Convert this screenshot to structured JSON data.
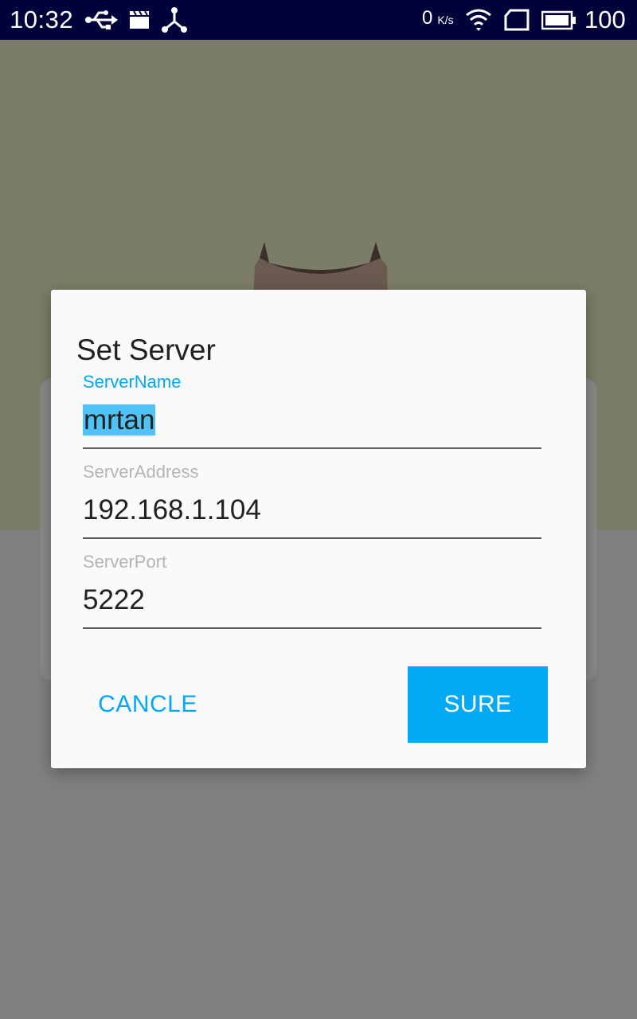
{
  "status_bar": {
    "time": "10:32",
    "network_speed": "0",
    "network_speed_unit": "K/s",
    "battery_level": "100",
    "icons": [
      "usb-icon",
      "clapperboard-icon",
      "share-icon",
      "wifi-icon",
      "sim-icon",
      "battery-icon"
    ]
  },
  "dialog": {
    "title": "Set Server",
    "fields": [
      {
        "label": "ServerName",
        "value": "mrtan",
        "focused": true,
        "selected": true
      },
      {
        "label": "ServerAddress",
        "value": "192.168.1.104",
        "focused": false
      },
      {
        "label": "ServerPort",
        "value": "5222",
        "focused": false
      }
    ],
    "cancel_label": "CANCLE",
    "sure_label": "SURE"
  },
  "colors": {
    "accent": "#03a9f4",
    "status_bar": "#01023a",
    "selection": "#4fc3f7",
    "scrim_background": "#808080"
  }
}
